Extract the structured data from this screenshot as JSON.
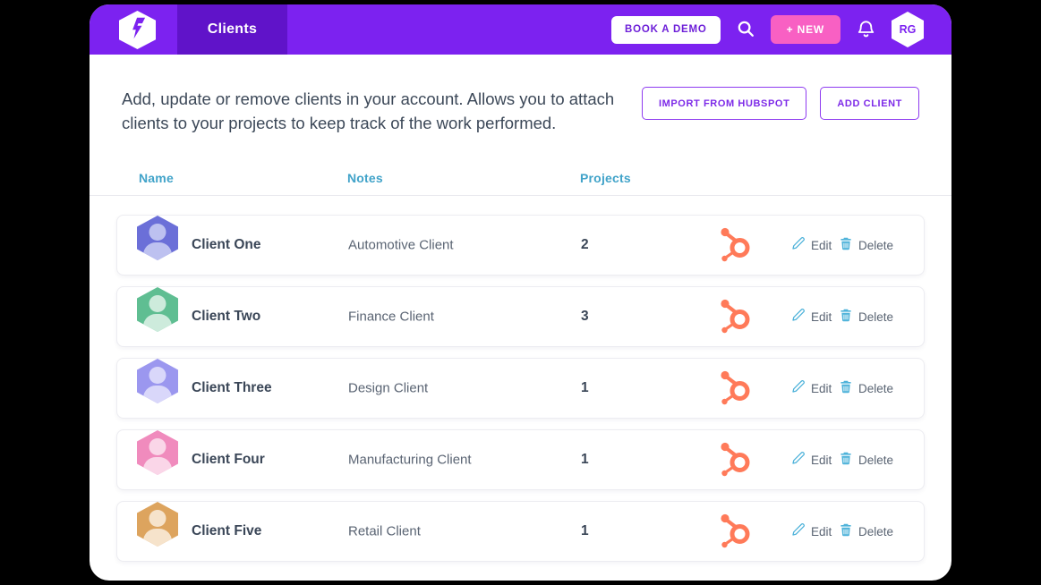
{
  "colors": {
    "header_purple": "#7C22F0",
    "tab_purple": "#6013C9",
    "accent_pink": "#F860C3",
    "accent_purple": "#7D2AE8",
    "column_teal": "#41A3C9",
    "action_icon_teal": "#4FB3DA",
    "hubspot_orange": "#FF7A59",
    "text_dark": "#3A4657",
    "text_gray": "#5A6473"
  },
  "icons": {
    "logo": "hexagon-bolt-f-logo",
    "search": "magnifier",
    "bell": "notification-bell",
    "avatar": "hexagon-person",
    "hubspot": "hubspot-sprocket",
    "edit": "pencil",
    "delete": "trash"
  },
  "header": {
    "tab": "Clients",
    "book_demo": "BOOK A DEMO",
    "new_button": "+ NEW",
    "avatar_initials": "RG"
  },
  "intro": {
    "description": "Add, update or remove clients in your account. Allows you to attach clients to your projects to keep track of the work performed.",
    "import_button": "IMPORT FROM HUBSPOT",
    "add_button": "ADD CLIENT"
  },
  "table": {
    "columns": [
      "Name",
      "Notes",
      "Projects"
    ],
    "actions": {
      "edit": "Edit",
      "delete": "Delete"
    },
    "rows": [
      {
        "name": "Client One",
        "notes": "Automotive Client",
        "projects": "2",
        "avatar_color": "#6B6FD8",
        "avatar_tint": "#BDC1F0"
      },
      {
        "name": "Client Two",
        "notes": "Finance Client",
        "projects": "3",
        "avatar_color": "#5FBE92",
        "avatar_tint": "#CDEBDC"
      },
      {
        "name": "Client Three",
        "notes": "Design Client",
        "projects": "1",
        "avatar_color": "#9B97EF",
        "avatar_tint": "#D9D7FA"
      },
      {
        "name": "Client Four",
        "notes": "Manufacturing Client",
        "projects": "1",
        "avatar_color": "#F08BBD",
        "avatar_tint": "#FAD6E8"
      },
      {
        "name": "Client Five",
        "notes": "Retail Client",
        "projects": "1",
        "avatar_color": "#DDA45E",
        "avatar_tint": "#F6E3CB"
      }
    ]
  }
}
